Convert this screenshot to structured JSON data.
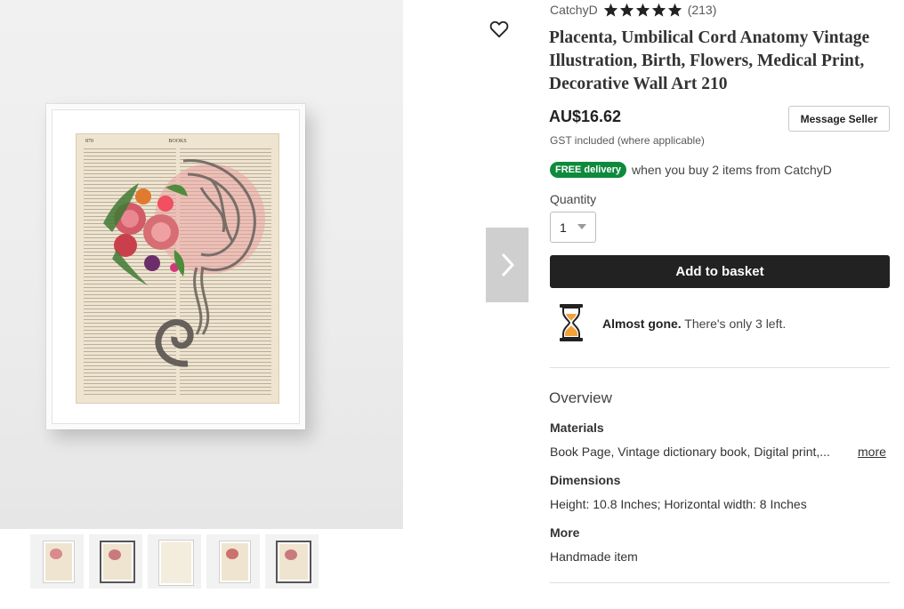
{
  "product": {
    "title": "Placenta, Umbilical Cord Anatomy Vintage Illustration, Birth, Flowers, Medical Print, Decorative Wall Art 210",
    "price": "AU$16.62",
    "gst_note": "GST included (where applicable)",
    "image_page_heading": "BOOKS",
    "image_page_number": "870",
    "rating_stars": 5
  },
  "shop": {
    "name": "CatchyD",
    "review_count": "(213)"
  },
  "actions": {
    "message_seller": "Message Seller",
    "add_to_basket": "Add to basket"
  },
  "delivery": {
    "badge": "FREE delivery",
    "text": "when you buy 2 items from CatchyD"
  },
  "quantity": {
    "label": "Quantity",
    "selected": "1"
  },
  "stock": {
    "bold": "Almost gone.",
    "text": " There's only 3 left."
  },
  "overview": {
    "heading": "Overview",
    "materials_label": "Materials",
    "materials_value": "Book Page, Vintage dictionary book, Digital print,...",
    "more_link": "more",
    "dimensions_label": "Dimensions",
    "dimensions_value": "Height: 10.8 Inches; Horizontal width: 8 Inches",
    "more_label": "More",
    "more_value": "Handmade item"
  },
  "icons": {
    "favorite": "heart-icon",
    "next": "chevron-right-icon",
    "stock": "hourglass-icon",
    "rating": "star-icon"
  },
  "colors": {
    "button_dark": "#222222",
    "delivery_green": "#0f8a3d",
    "hourglass_orange": "#f1a33a"
  }
}
